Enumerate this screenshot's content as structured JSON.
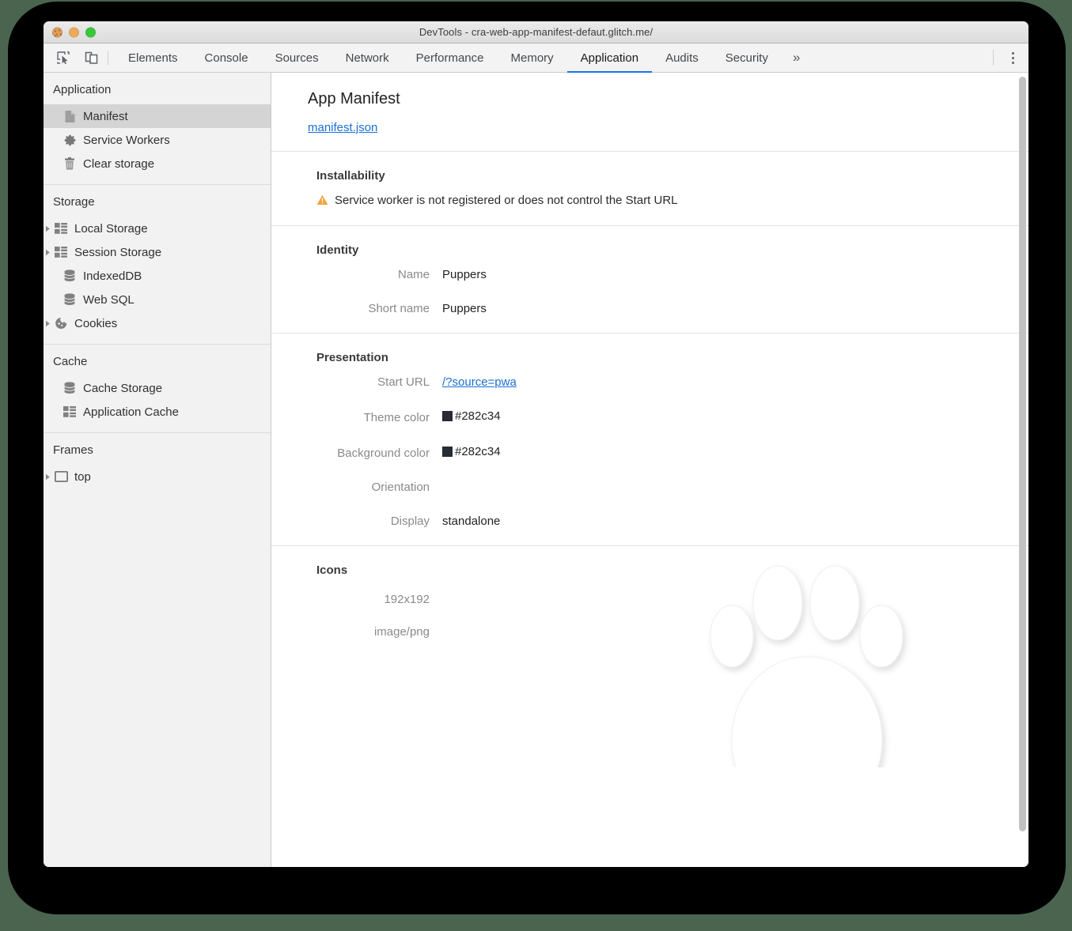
{
  "window": {
    "title": "DevTools - cra-web-app-manifest-defaut.glitch.me/",
    "traffic_lights": [
      "close",
      "minimize",
      "maximize"
    ]
  },
  "toolbar": {
    "inspect_icon": "inspect-element-icon",
    "device_icon": "device-toolbar-icon",
    "menu_icon": "kebab-menu-icon",
    "tabs": [
      {
        "label": "Elements",
        "active": false
      },
      {
        "label": "Console",
        "active": false
      },
      {
        "label": "Sources",
        "active": false
      },
      {
        "label": "Network",
        "active": false
      },
      {
        "label": "Performance",
        "active": false
      },
      {
        "label": "Memory",
        "active": false
      },
      {
        "label": "Application",
        "active": true
      },
      {
        "label": "Audits",
        "active": false
      },
      {
        "label": "Security",
        "active": false
      }
    ],
    "more_tabs_label": "»",
    "accent_color": "#1a73e8"
  },
  "sidebar": {
    "sections": [
      {
        "header": "Application",
        "items": [
          {
            "label": "Manifest",
            "icon": "document-icon",
            "selected": true,
            "twisty": false
          },
          {
            "label": "Service Workers",
            "icon": "gear-icon",
            "selected": false,
            "twisty": false
          },
          {
            "label": "Clear storage",
            "icon": "trash-icon",
            "selected": false,
            "twisty": false
          }
        ]
      },
      {
        "header": "Storage",
        "items": [
          {
            "label": "Local Storage",
            "icon": "table-icon",
            "selected": false,
            "twisty": true
          },
          {
            "label": "Session Storage",
            "icon": "table-icon",
            "selected": false,
            "twisty": true
          },
          {
            "label": "IndexedDB",
            "icon": "database-icon",
            "selected": false,
            "twisty": false
          },
          {
            "label": "Web SQL",
            "icon": "database-icon",
            "selected": false,
            "twisty": false
          },
          {
            "label": "Cookies",
            "icon": "cookie-icon",
            "selected": false,
            "twisty": true
          }
        ]
      },
      {
        "header": "Cache",
        "items": [
          {
            "label": "Cache Storage",
            "icon": "database-icon",
            "selected": false,
            "twisty": false
          },
          {
            "label": "Application Cache",
            "icon": "table-icon",
            "selected": false,
            "twisty": false
          }
        ]
      },
      {
        "header": "Frames",
        "items": [
          {
            "label": "top",
            "icon": "frame-icon",
            "selected": false,
            "twisty": true
          }
        ]
      }
    ]
  },
  "main": {
    "page_title": "App Manifest",
    "manifest_link": "manifest.json",
    "installability": {
      "heading": "Installability",
      "warning_icon": "warning-triangle-icon",
      "warning_text": "Service worker is not registered or does not control the Start URL"
    },
    "identity": {
      "heading": "Identity",
      "fields": [
        {
          "label": "Name",
          "value": "Puppers",
          "type": "text"
        },
        {
          "label": "Short name",
          "value": "Puppers",
          "type": "text"
        }
      ]
    },
    "presentation": {
      "heading": "Presentation",
      "fields": [
        {
          "label": "Start URL",
          "value": "/?source=pwa",
          "type": "link"
        },
        {
          "label": "Theme color",
          "value": "#282c34",
          "type": "color",
          "swatch": "#282c34"
        },
        {
          "label": "Background color",
          "value": "#282c34",
          "type": "color",
          "swatch": "#282c34"
        },
        {
          "label": "Orientation",
          "value": "",
          "type": "text"
        },
        {
          "label": "Display",
          "value": "standalone",
          "type": "text"
        }
      ]
    },
    "icons": {
      "heading": "Icons",
      "size": "192x192",
      "mime": "image/png",
      "preview": "paw-print-image"
    }
  },
  "scrollbar": {
    "name": "vertical-scrollbar",
    "thumb_color": "#c2c2c2"
  }
}
